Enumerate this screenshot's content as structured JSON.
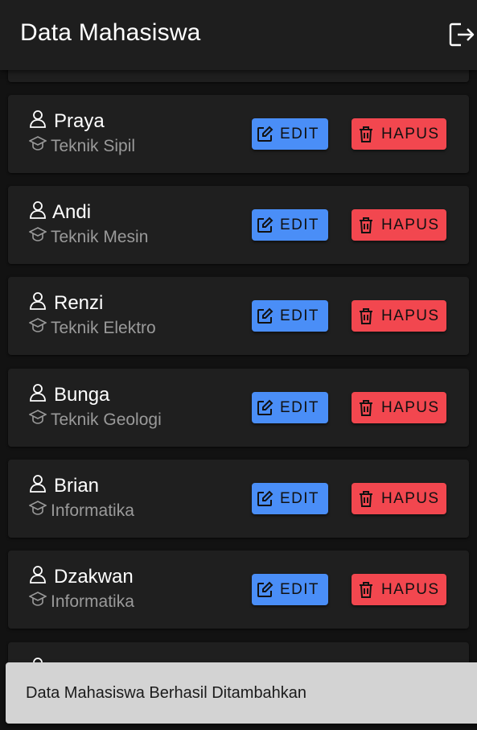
{
  "appbar": {
    "title": "Data Mahasiswa",
    "logout_icon": "logout-icon"
  },
  "students": [
    {
      "name": "Praya",
      "major": "Teknik Sipil"
    },
    {
      "name": "Andi",
      "major": "Teknik Mesin"
    },
    {
      "name": "Renzi",
      "major": "Teknik Elektro"
    },
    {
      "name": "Bunga",
      "major": "Teknik Geologi"
    },
    {
      "name": "Brian",
      "major": "Informatika"
    },
    {
      "name": "Dzakwan",
      "major": "Informatika"
    }
  ],
  "actions": {
    "edit_label": "EDIT",
    "delete_label": "HAPUS"
  },
  "snackbar": {
    "message": "Data Mahasiswa Berhasil Ditambahkan"
  },
  "colors": {
    "edit": "#4a8ef7",
    "delete": "#f2474f",
    "surface": "#1f1f1f",
    "background": "#121212"
  }
}
